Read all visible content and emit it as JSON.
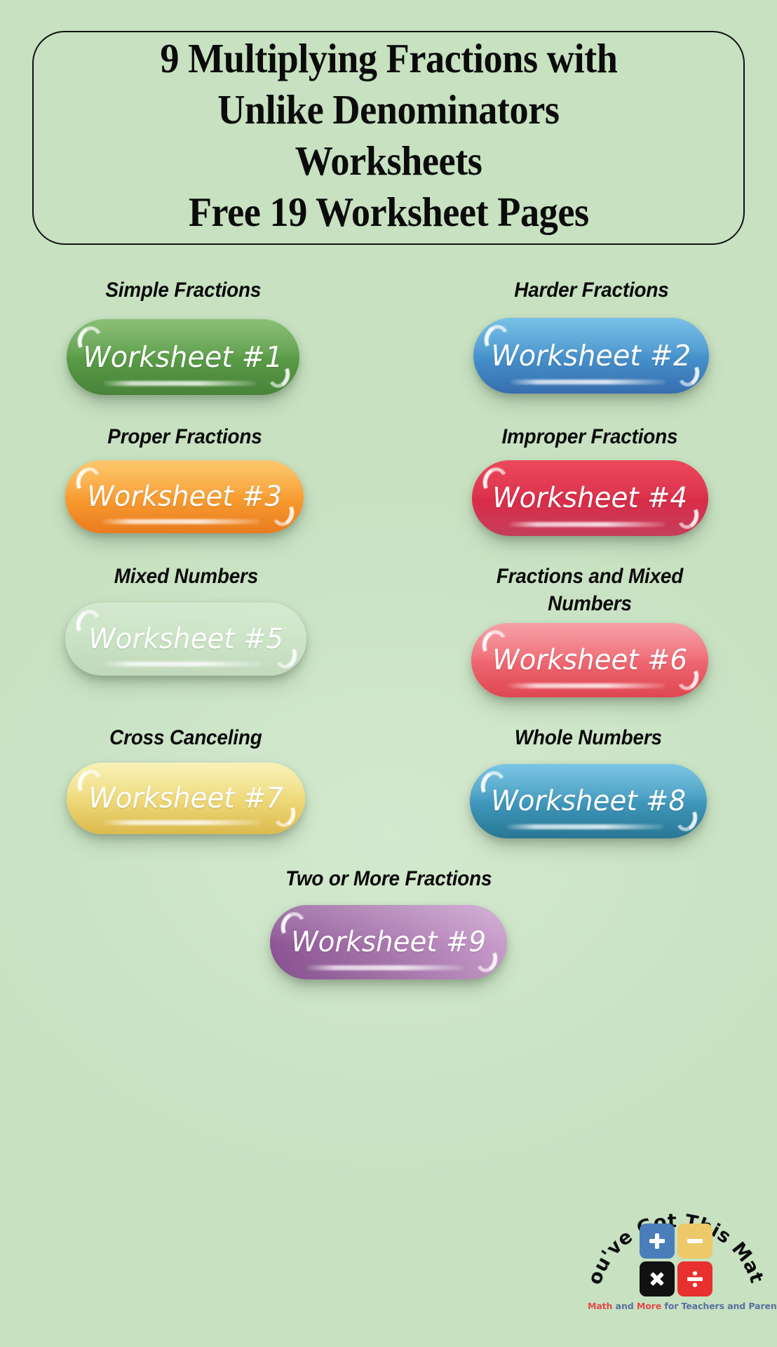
{
  "colors": {
    "background": "#c7e1c1",
    "title_border": "#111111",
    "title_text": "#0b0b0b",
    "label_text": "#0a0a0a",
    "button_text": "#ffffff",
    "logo_plus_tile": "#4a7ebb",
    "logo_minus_tile": "#edc96a",
    "logo_times_tile": "#111111",
    "logo_divide_tile": "#e8302f",
    "logo_tagline_red": "#e8464a",
    "logo_tagline_blue": "#5a6f9e"
  },
  "title": {
    "lines": [
      "9 Multiplying Fractions with",
      "Unlike Denominators",
      "Worksheets",
      "Free 19 Worksheet Pages"
    ]
  },
  "worksheets": [
    {
      "label": "Simple Fractions",
      "button_label": "Worksheet #1",
      "color_start": "#6aad52",
      "color_end": "#4b8a3c",
      "gradient": "vertical"
    },
    {
      "label": "Harder Fractions",
      "button_label": "Worksheet #2",
      "color_start": "#52b0e0",
      "color_end": "#3a74b8",
      "gradient": "vertical"
    },
    {
      "label": "Proper Fractions",
      "button_label": "Worksheet #3",
      "color_start": "#fbb843",
      "color_end": "#f58220",
      "gradient": "vertical"
    },
    {
      "label": "Improper Fractions",
      "button_label": "Worksheet #4",
      "color_start": "#e5162e",
      "color_end": "#cf4060",
      "gradient": "vertical"
    },
    {
      "label": "Mixed Numbers",
      "button_label": "Worksheet #5",
      "color_start": "#6277bd",
      "color_end": "#b濃"
    },
    {
      "label": "Fractions and Mixed Numbers",
      "button_label": "Worksheet #6",
      "color_start": "#f4868f",
      "color_end": "#ea4a55",
      "gradient": "vertical"
    },
    {
      "label": "Cross Canceling",
      "button_label": "Worksheet #7",
      "color_start": "#f6eea2",
      "color_end": "#e7c452",
      "gradient": "vertical"
    },
    {
      "label": "Whole Numbers",
      "button_label": "Worksheet #8",
      "color_start": "#56b4dd",
      "color_end": "#2a7d9c",
      "gradient": "vertical"
    },
    {
      "label": "Two or More Fractions",
      "button_label": "Worksheet #9",
      "color_start": "#8c5494",
      "color_end": "#c89ccb",
      "gradient": "horizontal"
    }
  ],
  "logo": {
    "curved_text": "You've Got This Math",
    "tiles": [
      {
        "name": "plus-tile",
        "glyph": "+",
        "bg": "#4a7ebb"
      },
      {
        "name": "minus-tile",
        "glyph": "−",
        "bg": "#edc96a"
      },
      {
        "name": "times-tile",
        "glyph": "×",
        "bg": "#111111"
      },
      {
        "name": "divide-tile",
        "glyph": "÷",
        "bg": "#e8302f"
      }
    ],
    "tagline_parts": [
      {
        "text": "Math",
        "color": "red"
      },
      {
        "text": " and ",
        "color": "blue"
      },
      {
        "text": "More",
        "color": "red"
      },
      {
        "text": " for Teachers and Parents",
        "color": "blue"
      }
    ]
  }
}
